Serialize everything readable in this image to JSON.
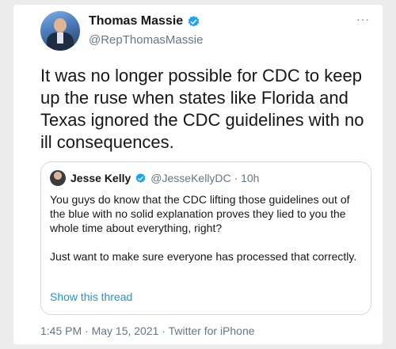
{
  "tweet": {
    "author_name": "Thomas Massie",
    "author_handle": "@RepThomasMassie",
    "more_label": "···",
    "text": "It was no longer possible for CDC to keep up the ruse when states like Florida and Texas ignored the CDC guidelines with no ill consequences.",
    "footer": "1:45 PM · May 15, 2021 · Twitter for iPhone"
  },
  "quoted_tweet": {
    "author_name": "Jesse Kelly",
    "author_handle": "@JesseKellyDC",
    "separator": " · ",
    "time": "10h",
    "paragraph_1": "You guys do know that the CDC lifting those guidelines out of the blue with no solid explanation proves they lied to you the whole time about everything, right?",
    "paragraph_2": "Just want to make sure everyone has processed that correctly.",
    "show_thread_label": "Show this thread"
  },
  "colors": {
    "verified": "#1da1f2",
    "link": "#1b95e0",
    "secondary_text": "#657786",
    "border": "#cfd9de"
  }
}
